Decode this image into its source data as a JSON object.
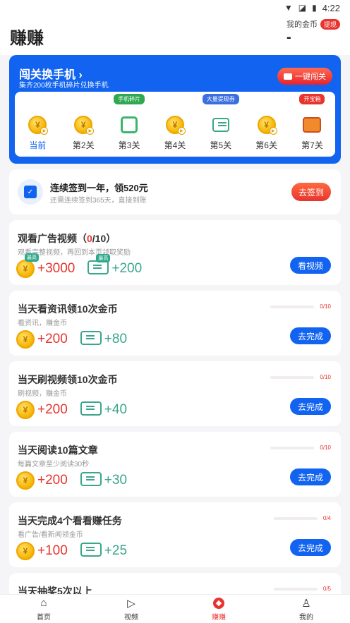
{
  "status": {
    "time": "4:22"
  },
  "header": {
    "title": "赚赚",
    "coins_label": "我的金币",
    "coins_badge": "提现",
    "coins_value": "-"
  },
  "promo": {
    "title": "闯关换手机 ›",
    "subtitle": "集齐200枚手机碎片兑换手机",
    "button": "一键闯关",
    "levels": [
      {
        "name": "当前",
        "icon": "coin-icon",
        "tag": ""
      },
      {
        "name": "第2关",
        "icon": "coin-icon",
        "tag": ""
      },
      {
        "name": "第3关",
        "icon": "puzzle-icon",
        "tag": "手机碎片"
      },
      {
        "name": "第4关",
        "icon": "coin-icon",
        "tag": ""
      },
      {
        "name": "第5关",
        "icon": "ticket-icon",
        "tag": "大量提现券"
      },
      {
        "name": "第6关",
        "icon": "coin-icon",
        "tag": ""
      },
      {
        "name": "第7关",
        "icon": "treasure-chest-icon",
        "tag": "开宝箱"
      }
    ]
  },
  "checkin": {
    "title": "连续签到一年，领520元",
    "subtitle": "还需连续签到365天，直接到账",
    "button": "去签到"
  },
  "tasks": [
    {
      "title_a": "观看广告视频（",
      "title_red": "0",
      "title_b": "/10）",
      "subtitle": "观看完整视频，再回到本页领取奖励",
      "coins": "+3000",
      "tickets": "+200",
      "tag": "最高",
      "button": "看视频",
      "progress": ""
    },
    {
      "title_a": "当天看资讯领10次金币",
      "title_red": "",
      "title_b": "",
      "subtitle": "看资讯，赚金币",
      "coins": "+200",
      "tickets": "+80",
      "tag": "",
      "button": "去完成",
      "progress": "0/10"
    },
    {
      "title_a": "当天刷视频领10次金币",
      "title_red": "",
      "title_b": "",
      "subtitle": "刷视频，赚金币",
      "coins": "+200",
      "tickets": "+40",
      "tag": "",
      "button": "去完成",
      "progress": "0/10"
    },
    {
      "title_a": "当天阅读10篇文章",
      "title_red": "",
      "title_b": "",
      "subtitle": "每篇文章至少阅读30秒",
      "coins": "+200",
      "tickets": "+30",
      "tag": "",
      "button": "去完成",
      "progress": "0/10"
    },
    {
      "title_a": "当天完成4个看看赚任务",
      "title_red": "",
      "title_b": "",
      "subtitle": "看广告/看新闻领金币",
      "coins": "+100",
      "tickets": "+25",
      "tag": "",
      "button": "去完成",
      "progress": "0/4"
    },
    {
      "title_a": "当天抽奖5次以上",
      "title_red": "",
      "title_b": "",
      "subtitle": "",
      "coins": "",
      "tickets": "",
      "tag": "",
      "button": "",
      "progress": "0/5"
    }
  ],
  "tabbar": {
    "items": [
      "首页",
      "视频",
      "赚赚",
      "我的"
    ],
    "active": 2
  },
  "colors": {
    "accent": "#1163f0",
    "red": "#e8342f",
    "green": "#3aa68a"
  }
}
